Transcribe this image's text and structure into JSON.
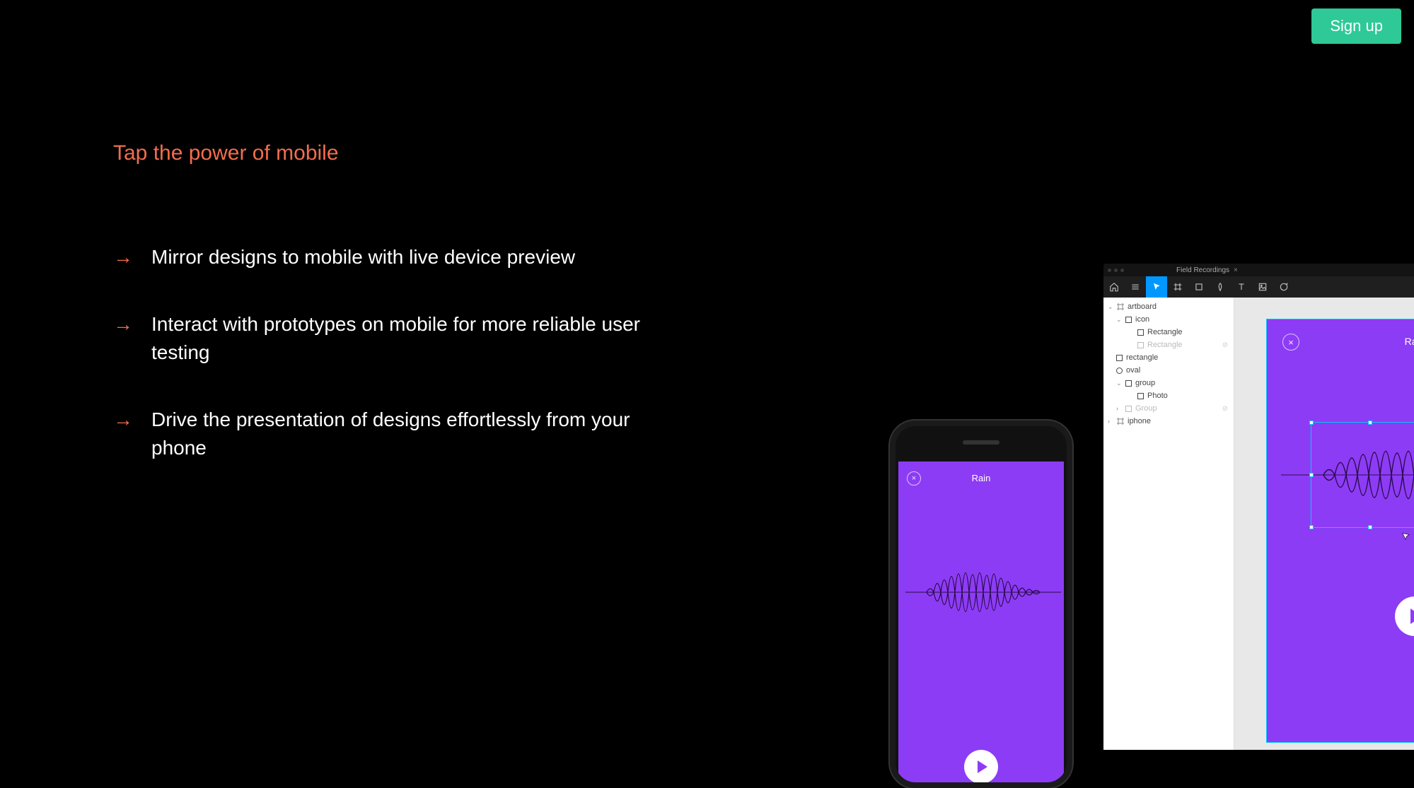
{
  "cta": {
    "signup": "Sign up"
  },
  "heading": "Tap the power of mobile",
  "features": [
    "Mirror designs to mobile with live device preview",
    "Interact with prototypes on mobile for more reliable user testing",
    "Drive the presentation of designs effortlessly from your phone"
  ],
  "phone": {
    "title": "Rain",
    "close_glyph": "×"
  },
  "editor": {
    "tab_name": "Field Recordings",
    "tab_close": "×",
    "layers": {
      "artboard": "artboard",
      "icon": "icon",
      "rectangle_cap": "Rectangle",
      "rectangle_cap2": "Rectangle",
      "rectangle_low": "rectangle",
      "oval": "oval",
      "group": "group",
      "photo": "Photo",
      "group_dim": "Group",
      "iphone": "iphone"
    },
    "canvas": {
      "title": "Rain",
      "close_glyph": "×"
    }
  },
  "colors": {
    "accent_orange": "#f26d4e",
    "cta_green": "#2ec997",
    "purple": "#8d3cf5",
    "selection_blue": "#00c8ff",
    "toolbar_active": "#0098ff"
  }
}
